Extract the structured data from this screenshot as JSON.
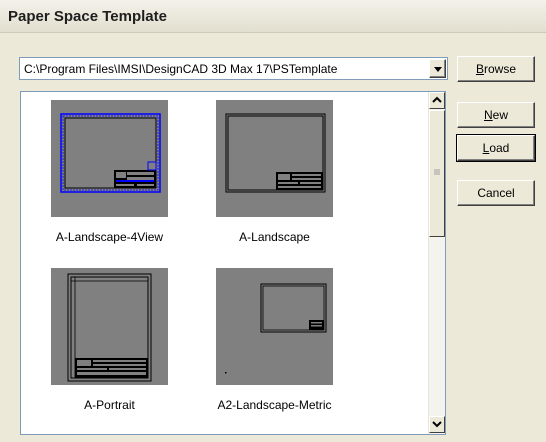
{
  "window": {
    "title": "Paper Space Template"
  },
  "path": {
    "value": "C:\\Program Files\\IMSI\\DesignCAD 3D Max 17\\PSTemplate"
  },
  "buttons": {
    "browse": {
      "accel": "B",
      "rest": "rowse"
    },
    "new": {
      "accel": "N",
      "rest": "ew"
    },
    "load": {
      "accel": "L",
      "rest": "oad"
    },
    "cancel": "Cancel"
  },
  "templates": [
    {
      "label": "A-Landscape-4View"
    },
    {
      "label": "A-Landscape"
    },
    {
      "label": "A-Portrait"
    },
    {
      "label": "A2-Landscape-Metric"
    }
  ],
  "icons": [
    "chevron-up-icon",
    "chevron-down-icon",
    "grip-icon",
    "chevron-down-icon"
  ],
  "colors": {
    "thumb_bg": "#808080",
    "drawing_blue": "#0000ff",
    "field_border": "#7f9db9"
  }
}
